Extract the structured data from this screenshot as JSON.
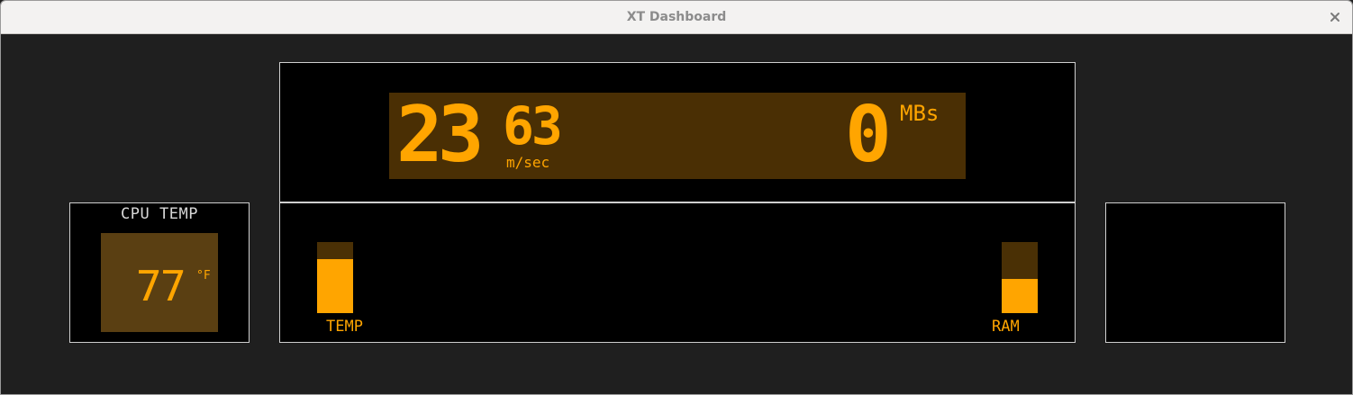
{
  "window": {
    "title": "XT Dashboard",
    "close_icon": "close-icon"
  },
  "colors": {
    "accent": "#ffa500",
    "lcd_background": "#4a2f04",
    "cpu_display_background": "#5a3f12",
    "panel_border": "#cfcfcf",
    "background": "#1f1f1f"
  },
  "cpu_temp": {
    "label": "CPU TEMP",
    "value": "77",
    "unit": "°F"
  },
  "speed": {
    "value_big": "23",
    "value_small": "63",
    "unit": "m/sec"
  },
  "throughput": {
    "value": "0",
    "unit": "MBs"
  },
  "gauges": {
    "temp": {
      "label": "TEMP",
      "level": 0.76
    },
    "ram": {
      "label": "RAM",
      "level": 0.48
    }
  }
}
